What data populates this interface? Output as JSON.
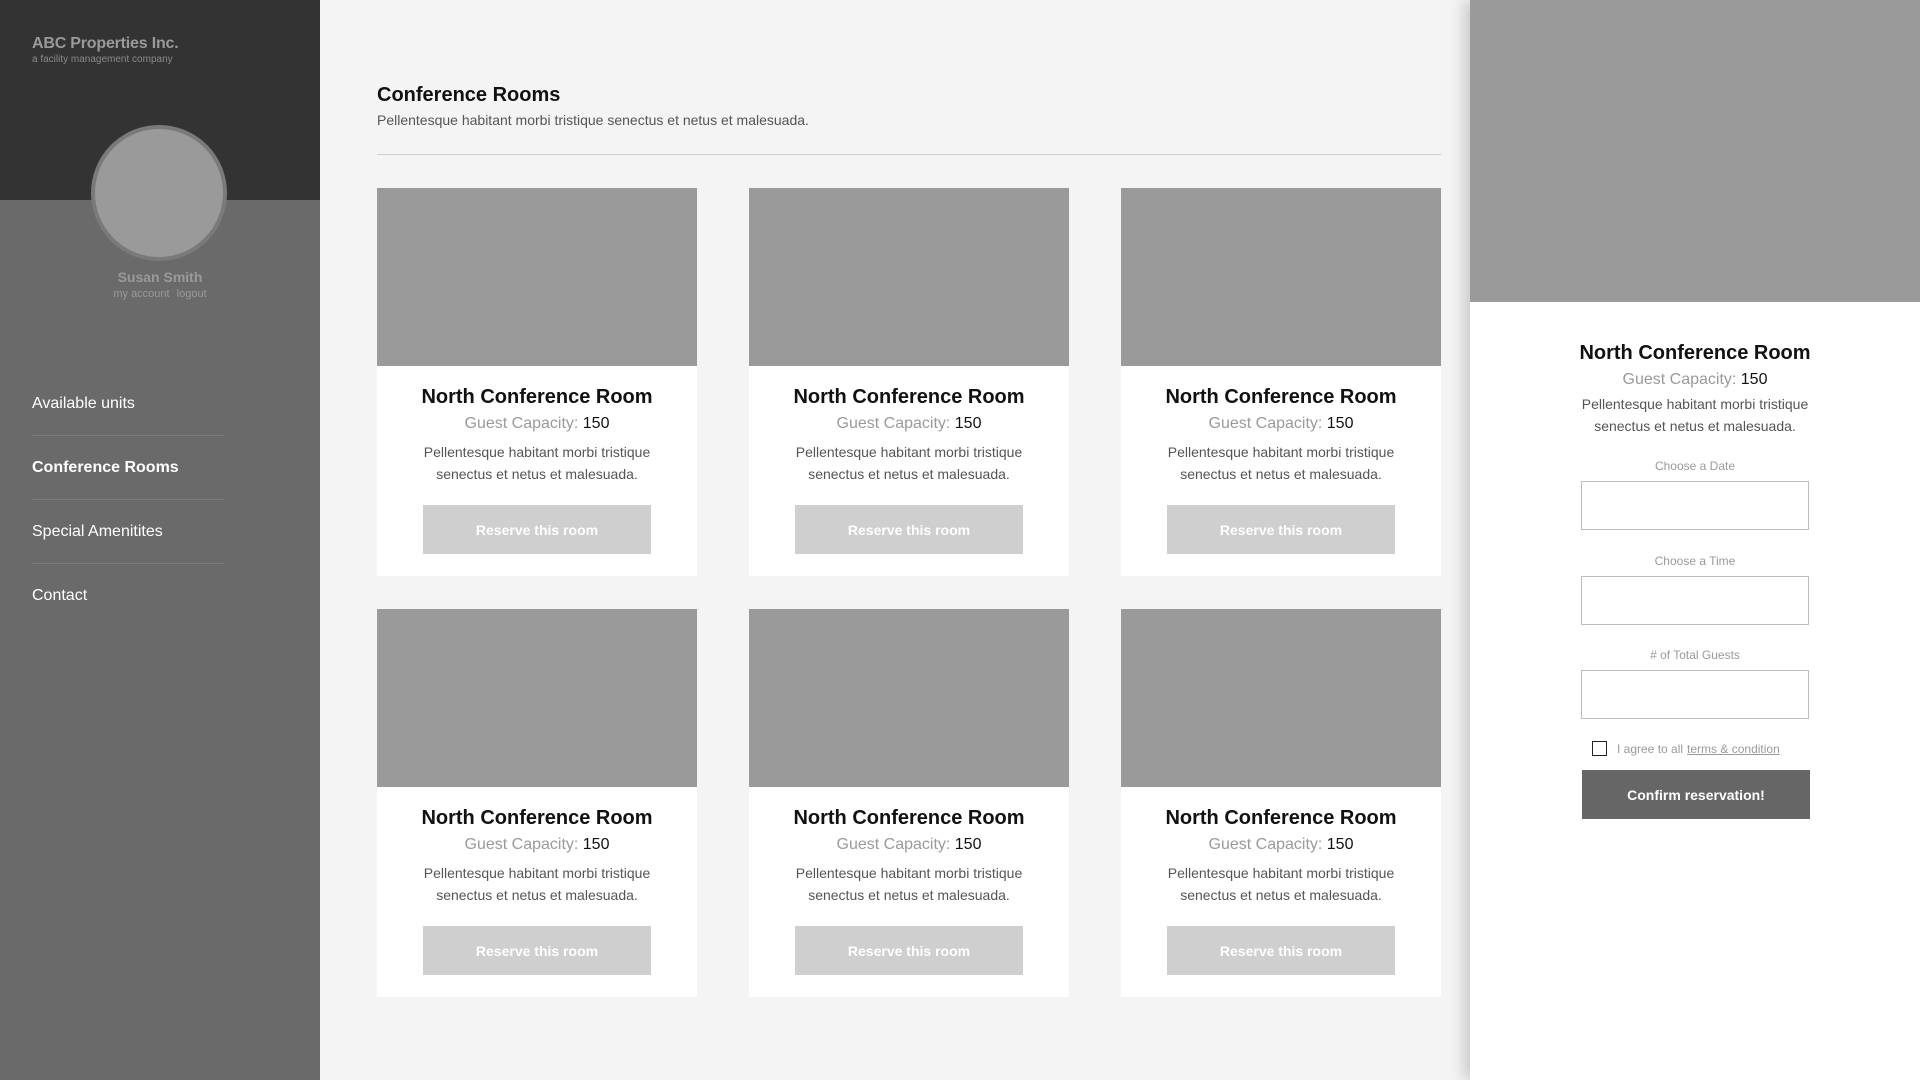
{
  "brand": {
    "name": "ABC Properties Inc.",
    "tagline": "a facility management company"
  },
  "user": {
    "name": "Susan Smith",
    "links": [
      "my account",
      "logout"
    ]
  },
  "nav": {
    "items": [
      {
        "label": "Available units",
        "active": false
      },
      {
        "label": "Conference Rooms",
        "active": true
      },
      {
        "label": "Special Amenitites",
        "active": false
      },
      {
        "label": "Contact",
        "active": false
      }
    ]
  },
  "page": {
    "title": "Conference Rooms",
    "subtitle": "Pellentesque habitant morbi tristique senectus et netus et malesuada."
  },
  "rooms": [
    {
      "name": "North Conference Room",
      "capacity_label": "Guest Capacity:",
      "capacity": "150",
      "description": "Pellentesque habitant morbi tristique senectus et netus et malesuada.",
      "button": "Reserve this room"
    },
    {
      "name": "North Conference Room",
      "capacity_label": "Guest Capacity:",
      "capacity": "150",
      "description": "Pellentesque habitant morbi tristique senectus et netus et malesuada.",
      "button": "Reserve this room"
    },
    {
      "name": "North Conference Room",
      "capacity_label": "Guest Capacity:",
      "capacity": "150",
      "description": "Pellentesque habitant morbi tristique senectus et netus et malesuada.",
      "button": "Reserve this room"
    },
    {
      "name": "North Conference Room",
      "capacity_label": "Guest Capacity:",
      "capacity": "150",
      "description": "Pellentesque habitant morbi tristique senectus et netus et malesuada.",
      "button": "Reserve this room"
    },
    {
      "name": "North Conference Room",
      "capacity_label": "Guest Capacity:",
      "capacity": "150",
      "description": "Pellentesque habitant morbi tristique senectus et netus et malesuada.",
      "button": "Reserve this room"
    },
    {
      "name": "North Conference Room",
      "capacity_label": "Guest Capacity:",
      "capacity": "150",
      "description": "Pellentesque habitant morbi tristique senectus et netus et malesuada.",
      "button": "Reserve this room"
    }
  ],
  "panel": {
    "title": "North Conference Room",
    "capacity_label": "Guest Capacity:",
    "capacity": "150",
    "description": "Pellentesque habitant morbi tristique senectus et netus et malesuada.",
    "fields": [
      {
        "label": "Choose a Date",
        "value": ""
      },
      {
        "label": "Choose a Time",
        "value": ""
      },
      {
        "label": "# of Total Guests",
        "value": ""
      }
    ],
    "agree_text": "I agree to all",
    "agree_link": "terms & condition",
    "agree_checked": false,
    "confirm_label": "Confirm reservation!"
  },
  "colors": {
    "sidebar_dark": "#333333",
    "sidebar": "#6a6a6a",
    "placeholder_image": "#9a9a9a",
    "reserve_button": "#cfcfcf",
    "confirm_button": "#666666"
  }
}
